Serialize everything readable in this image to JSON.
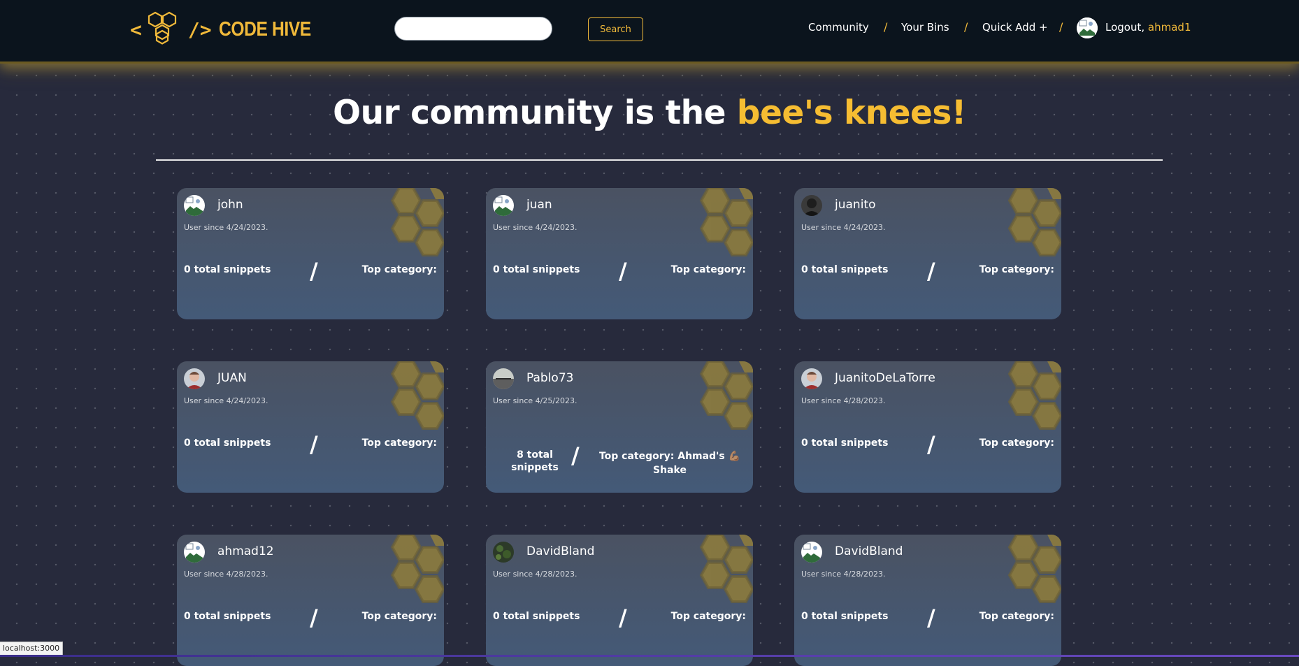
{
  "header": {
    "logo_open": "<",
    "logo_close": "/>",
    "logo_text": "CODE HIVE",
    "search_placeholder": "",
    "search_label": "Search",
    "nav": [
      "Community",
      "Your Bins",
      "Quick Add +"
    ],
    "separator": "/",
    "logout_label": "Logout,",
    "username": "ahmad1"
  },
  "hero": {
    "title_main": "Our community is the",
    "title_accent": "bee's knees!"
  },
  "cards": [
    {
      "name": "john",
      "since": "User since 4/24/2023.",
      "snippets": "0 total snippets",
      "category": "Top category:",
      "avatar": "broken-image"
    },
    {
      "name": "juan",
      "since": "User since 4/24/2023.",
      "snippets": "0 total snippets",
      "category": "Top category:",
      "avatar": "broken-image"
    },
    {
      "name": "juanito",
      "since": "User since 4/24/2023.",
      "snippets": "0 total snippets",
      "category": "Top category:",
      "avatar": "dark-portrait"
    },
    {
      "name": "JUAN",
      "since": "User since 4/24/2023.",
      "snippets": "0 total snippets",
      "category": "Top category:",
      "avatar": "man-portrait"
    },
    {
      "name": "Pablo73",
      "since": "User since 4/25/2023.",
      "snippets": "8 total snippets",
      "category": "Top category: Ahmad's 💪🏽 Shake",
      "avatar": "landscape-photo"
    },
    {
      "name": "JuanitoDeLaTorre",
      "since": "User since 4/28/2023.",
      "snippets": "0 total snippets",
      "category": "Top category:",
      "avatar": "man-portrait"
    },
    {
      "name": "ahmad12",
      "since": "User since 4/28/2023.",
      "snippets": "0 total snippets",
      "category": "Top category:",
      "avatar": "broken-image"
    },
    {
      "name": "DavidBland",
      "since": "User since 4/28/2023.",
      "snippets": "0 total snippets",
      "category": "Top category:",
      "avatar": "green-photo"
    },
    {
      "name": "DavidBland",
      "since": "User since 4/28/2023.",
      "snippets": "0 total snippets",
      "category": "Top category:",
      "avatar": "broken-image"
    }
  ],
  "card_separator": "/",
  "status_bar": "localhost:3000",
  "colors": {
    "accent": "#f6bd32",
    "header_bg": "#0b141d",
    "page_bg": "#272a3c",
    "card_hex": "#8a7a40"
  }
}
